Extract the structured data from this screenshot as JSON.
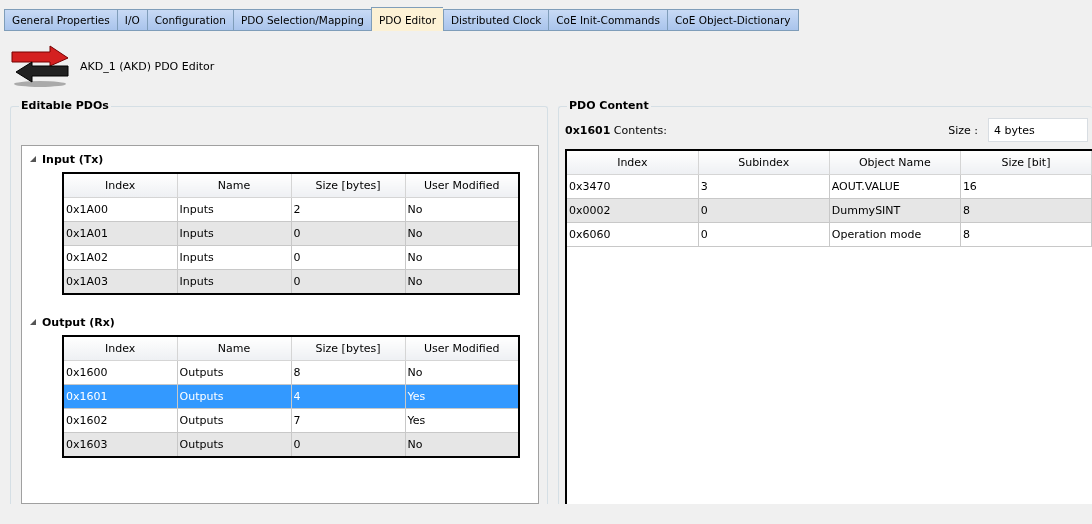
{
  "tabs": [
    {
      "label": "General Properties",
      "selected": false
    },
    {
      "label": "I/O",
      "selected": false
    },
    {
      "label": "Configuration",
      "selected": false
    },
    {
      "label": "PDO Selection/Mapping",
      "selected": false
    },
    {
      "label": "PDO Editor",
      "selected": true
    },
    {
      "label": "Distributed Clock",
      "selected": false
    },
    {
      "label": "CoE Init-Commands",
      "selected": false
    },
    {
      "label": "CoE Object-Dictionary",
      "selected": false
    }
  ],
  "header": {
    "title": "AKD_1 (AKD) PDO Editor"
  },
  "editable_pdos": {
    "title": "Editable PDOs",
    "sections": [
      {
        "title": "Input (Tx)",
        "expanded": true,
        "columns": [
          "Index",
          "Name",
          "Size [bytes]",
          "User Modified"
        ],
        "rows": [
          {
            "cells": [
              "0x1A00",
              "Inputs",
              "2",
              "No"
            ],
            "selected": false
          },
          {
            "cells": [
              "0x1A01",
              "Inputs",
              "0",
              "No"
            ],
            "selected": false
          },
          {
            "cells": [
              "0x1A02",
              "Inputs",
              "0",
              "No"
            ],
            "selected": false
          },
          {
            "cells": [
              "0x1A03",
              "Inputs",
              "0",
              "No"
            ],
            "selected": false
          }
        ]
      },
      {
        "title": "Output (Rx)",
        "expanded": true,
        "columns": [
          "Index",
          "Name",
          "Size [bytes]",
          "User Modified"
        ],
        "rows": [
          {
            "cells": [
              "0x1600",
              "Outputs",
              "8",
              "No"
            ],
            "selected": false
          },
          {
            "cells": [
              "0x1601",
              "Outputs",
              "4",
              "Yes"
            ],
            "selected": true
          },
          {
            "cells": [
              "0x1602",
              "Outputs",
              "7",
              "Yes"
            ],
            "selected": false
          },
          {
            "cells": [
              "0x1603",
              "Outputs",
              "0",
              "No"
            ],
            "selected": false
          }
        ]
      }
    ]
  },
  "pdo_content": {
    "title": "PDO Content",
    "heading": "**0x1601** Contents:",
    "size_label": "Size :",
    "size_value": "4 bytes",
    "columns": [
      "Index",
      "Subindex",
      "Object Name",
      "Size [bit]"
    ],
    "rows": [
      {
        "cells": [
          "0x3470",
          "3",
          "AOUT.VALUE",
          "16"
        ]
      },
      {
        "cells": [
          "0x0002",
          "0",
          "DummySINT",
          "8"
        ]
      },
      {
        "cells": [
          "0x6060",
          "0",
          "Operation mode",
          "8"
        ]
      }
    ]
  }
}
